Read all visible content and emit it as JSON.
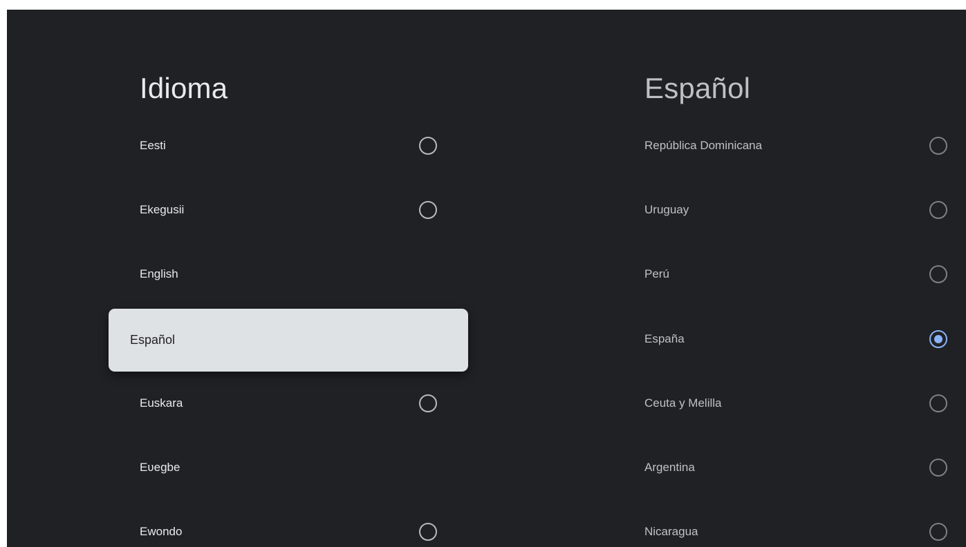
{
  "left_panel": {
    "title": "Idioma",
    "items": [
      {
        "label": "Eesti",
        "has_radio": true
      },
      {
        "label": "Ekegusii",
        "has_radio": true
      },
      {
        "label": "English",
        "has_radio": false
      },
      {
        "label": "Español",
        "has_radio": false,
        "focused": true
      },
      {
        "label": "Euskara",
        "has_radio": true
      },
      {
        "label": "Eʋegbe",
        "has_radio": false
      },
      {
        "label": "Ewondo",
        "has_radio": true
      }
    ]
  },
  "right_panel": {
    "title": "Español",
    "items": [
      {
        "label": "República Dominicana",
        "selected": false
      },
      {
        "label": "Uruguay",
        "selected": false
      },
      {
        "label": "Perú",
        "selected": false
      },
      {
        "label": "España",
        "selected": true
      },
      {
        "label": "Ceuta y Melilla",
        "selected": false
      },
      {
        "label": "Argentina",
        "selected": false
      },
      {
        "label": "Nicaragua",
        "selected": false
      }
    ]
  },
  "colors": {
    "background": "#202124",
    "focus_card": "#dfe2e5",
    "accent": "#8ab4f8"
  }
}
